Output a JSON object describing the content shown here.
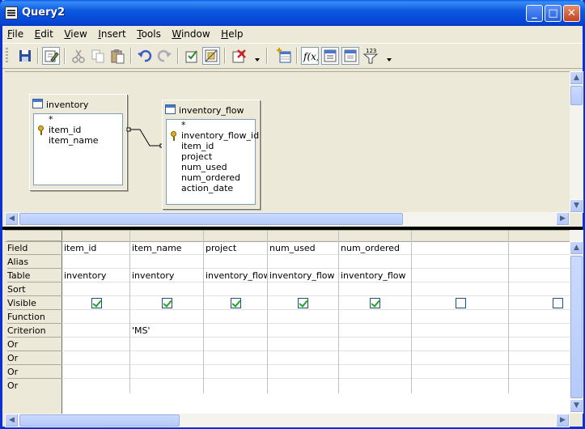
{
  "window": {
    "title": "Query2"
  },
  "menu": [
    {
      "pre": "",
      "u": "F",
      "post": "ile"
    },
    {
      "pre": "",
      "u": "E",
      "post": "dit"
    },
    {
      "pre": "",
      "u": "V",
      "post": "iew"
    },
    {
      "pre": "",
      "u": "I",
      "post": "nsert"
    },
    {
      "pre": "",
      "u": "T",
      "post": "ools"
    },
    {
      "pre": "",
      "u": "W",
      "post": "indow"
    },
    {
      "pre": "",
      "u": "H",
      "post": "elp"
    }
  ],
  "toolbar": {
    "icons": [
      "save-icon",
      "edit-mode-icon",
      "cut-icon",
      "copy-icon",
      "paste-icon",
      "undo-icon",
      "redo-icon",
      "run-query-icon",
      "design-view-icon",
      "clear-query-icon",
      "add-table-icon",
      "functions-icon",
      "table-name-icon",
      "alias-icon",
      "distinct-values-icon"
    ],
    "functions_label": "f(x)",
    "distinct_label": "123"
  },
  "tables": [
    {
      "name": "inventory",
      "fields": [
        "*",
        "item_id",
        "item_name"
      ],
      "primary_key": "item_id"
    },
    {
      "name": "inventory_flow",
      "fields": [
        "*",
        "inventory_flow_id",
        "item_id",
        "project",
        "num_used",
        "num_ordered",
        "action_date"
      ],
      "primary_key": "inventory_flow_id"
    }
  ],
  "grid": {
    "row_labels": [
      "Field",
      "Alias",
      "Table",
      "Sort",
      "Visible",
      "Function",
      "Criterion",
      "Or",
      "Or",
      "Or",
      "Or"
    ],
    "columns": [
      {
        "field": "item_id",
        "table": "inventory",
        "visible": true,
        "criterion": ""
      },
      {
        "field": "item_name",
        "table": "inventory",
        "visible": true,
        "criterion": "'MS'"
      },
      {
        "field": "project",
        "table": "inventory_flow",
        "visible": true,
        "criterion": ""
      },
      {
        "field": "num_used",
        "table": "inventory_flow",
        "visible": true,
        "criterion": ""
      },
      {
        "field": "num_ordered",
        "table": "inventory_flow",
        "visible": true,
        "criterion": ""
      },
      {
        "field": "",
        "table": "",
        "visible": false,
        "criterion": ""
      },
      {
        "field": "",
        "table": "",
        "visible": false,
        "criterion": ""
      }
    ]
  }
}
